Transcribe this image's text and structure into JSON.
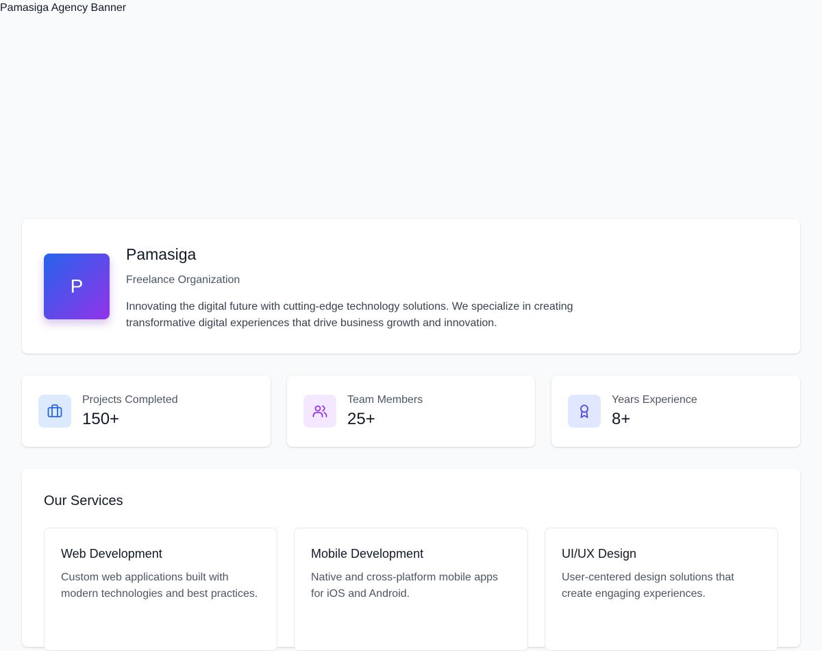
{
  "banner": {
    "alt": "Pamasiga Agency Banner"
  },
  "profile": {
    "initial": "P",
    "name": "Pamasiga",
    "type": "Freelance Organization",
    "description": "Innovating the digital future with cutting-edge technology solutions. We specialize in creating transformative digital experiences that drive business growth and innovation.",
    "gradient": [
      "#2563eb",
      "#9333ea"
    ]
  },
  "stats": [
    {
      "label": "Projects Completed",
      "value": "150+",
      "icon": "briefcase-icon",
      "icon_bg": "#dbeafe",
      "icon_color": "#2563eb"
    },
    {
      "label": "Team Members",
      "value": "25+",
      "icon": "users-icon",
      "icon_bg": "#f3e8ff",
      "icon_color": "#9333ea"
    },
    {
      "label": "Years Experience",
      "value": "8+",
      "icon": "award-icon",
      "icon_bg": "#e0e7ff",
      "icon_color": "#4f46e5"
    }
  ],
  "services": {
    "title": "Our Services",
    "items": [
      {
        "name": "Web Development",
        "description": "Custom web applications built with modern technologies and best practices."
      },
      {
        "name": "Mobile Development",
        "description": "Native and cross-platform mobile apps for iOS and Android."
      },
      {
        "name": "UI/UX Design",
        "description": "User-centered design solutions that create engaging experiences."
      }
    ]
  }
}
